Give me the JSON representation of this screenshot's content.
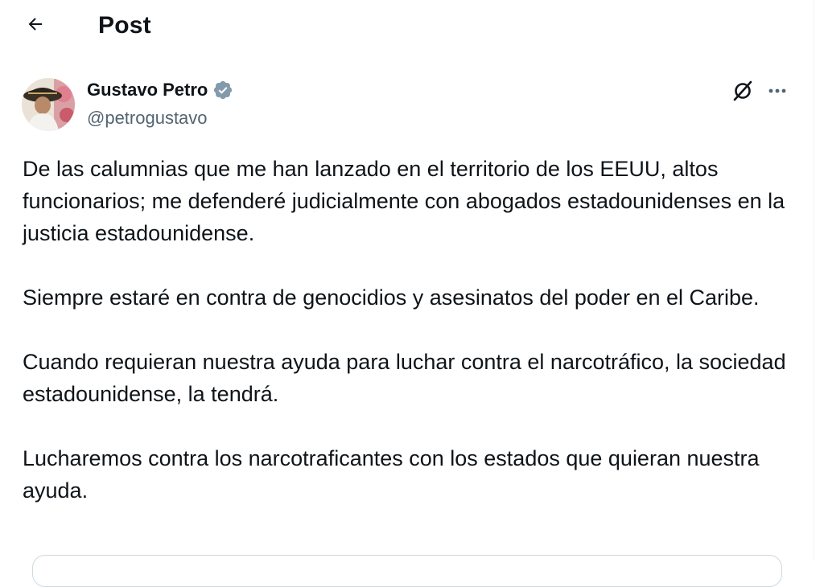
{
  "header": {
    "back_icon": "arrow-left-icon",
    "title": "Post"
  },
  "post": {
    "author": {
      "name": "Gustavo Petro",
      "handle": "@petrogustavo",
      "verified_icon": "verified-badge-icon",
      "verified_color": "#829aab"
    },
    "actions": {
      "grok_icon": "grok-icon",
      "more_icon": "more-horizontal-icon"
    },
    "paragraphs": [
      "De las calumnias que me han lanzado en el territorio de los EEUU, altos funcionarios; me defenderé judicialmente con abogados estadounidenses en la justicia estadounidense.",
      "Siempre estaré en contra de genocidios y asesinatos del poder en el Caribe.",
      "Cuando requieran nuestra ayuda para luchar contra el narcotráfico, la sociedad estadounidense, la tendrá.",
      "Lucharemos contra los narcotraficantes con los estados que quieran nuestra ayuda."
    ]
  },
  "colors": {
    "text_primary": "#0f1419",
    "text_secondary": "#536471",
    "border": "#cfd9de"
  }
}
